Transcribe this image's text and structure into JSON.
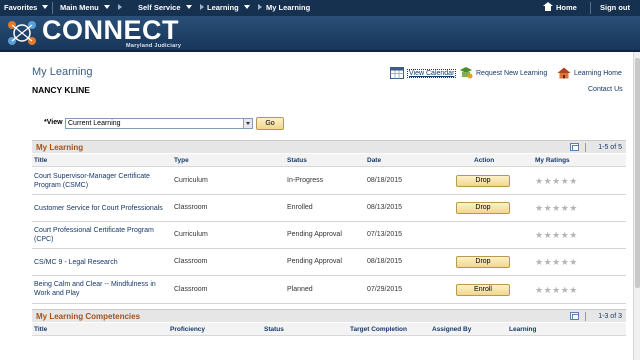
{
  "topnav": {
    "favorites": "Favorites",
    "main_menu": "Main Menu",
    "self_service": "Self Service",
    "learning": "Learning",
    "my_learning": "My Learning",
    "home": "Home",
    "sign_out": "Sign out"
  },
  "banner": {
    "logo_text": "CONNECT",
    "logo_sub": "Maryland Judiciary"
  },
  "page": {
    "title": "My Learning",
    "user_name": "NANCY KLINE",
    "view_calendar": "View Calendar",
    "request_learning": "Request New Learning",
    "learning_home": "Learning Home",
    "contact_us": "Contact Us"
  },
  "view": {
    "label": "*View",
    "selected": "Current Learning",
    "go": "Go"
  },
  "my_learning": {
    "title": "My Learning",
    "range": "1-5 of 5",
    "columns": {
      "title": "Title",
      "type": "Type",
      "status": "Status",
      "date": "Date",
      "action": "Action",
      "ratings": "My Ratings"
    },
    "rows": [
      {
        "title": "Court Supervisor-Manager Certificate Program (CSMC)",
        "type": "Curriculum",
        "status": "In-Progress",
        "date": "08/18/2015",
        "action": "Drop",
        "stars": "★★★★★"
      },
      {
        "title": "Customer Service for Court Professionals",
        "type": "Classroom",
        "status": "Enrolled",
        "date": "08/13/2015",
        "action": "Drop",
        "stars": "★★★★★"
      },
      {
        "title": "Court Professional Certificate Program (CPC)",
        "type": "Curriculum",
        "status": "Pending Approval",
        "date": "07/13/2015",
        "action": "",
        "stars": "★★★★★"
      },
      {
        "title": "CS/MC 9 - Legal Research",
        "type": "Classroom",
        "status": "Pending Approval",
        "date": "08/18/2015",
        "action": "Drop",
        "stars": "★★★★★"
      },
      {
        "title": "Being Calm and Clear -- Mindfulness in Work and Play",
        "type": "Classroom",
        "status": "Planned",
        "date": "07/29/2015",
        "action": "Enroll",
        "stars": "★★★★★"
      }
    ]
  },
  "competencies": {
    "title": "My Learning Competencies",
    "range": "1-3 of 3",
    "columns": {
      "title": "Title",
      "proficiency": "Proficiency",
      "status": "Status",
      "target": "Target Completion",
      "assigned": "Assigned By",
      "learning": "Learning"
    }
  }
}
